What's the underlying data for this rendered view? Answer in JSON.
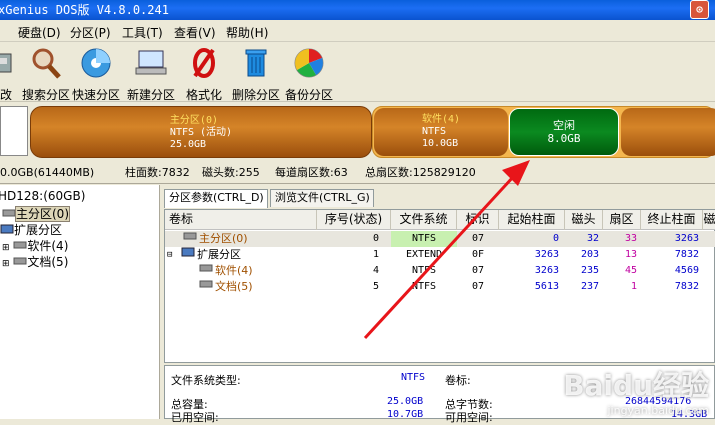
{
  "window": {
    "title": "xGenius DOS版 V4.8.0.241",
    "close_label": "⊙"
  },
  "menu": [
    "硬盘(D)",
    "分区(P)",
    "工具(T)",
    "查看(V)",
    "帮助(H)"
  ],
  "toolbar": [
    {
      "label": "更改",
      "icon": "disk-edit-icon"
    },
    {
      "label": "搜索分区",
      "icon": "magnifier-icon"
    },
    {
      "label": "快速分区",
      "icon": "disk-quick-icon"
    },
    {
      "label": "新建分区",
      "icon": "computer-new-icon"
    },
    {
      "label": "格式化",
      "icon": "format-icon"
    },
    {
      "label": "删除分区",
      "icon": "trash-icon"
    },
    {
      "label": "备份分区",
      "icon": "backup-icon"
    }
  ],
  "diskmap": {
    "main": {
      "name": "主分区(0)",
      "fs": "NTFS (活动)",
      "size": "25.0GB"
    },
    "sw": {
      "name": "软件(4)",
      "fs": "NTFS",
      "size": "10.0GB"
    },
    "free": {
      "name": "空闲",
      "size": "8.0GB"
    }
  },
  "info": {
    "capacity": "0.0GB(61440MB)",
    "cylinders": "柱面数:7832",
    "heads": "磁头数:255",
    "sectors_per_track": "每道扇区数:63",
    "total_sectors": "总扇区数:125829120"
  },
  "tree": {
    "disk": "HD128:(60GB)",
    "items": [
      "主分区(0)",
      "扩展分区",
      "软件(4)",
      "文档(5)"
    ]
  },
  "tabs": [
    "分区参数(CTRL_D)",
    "浏览文件(CTRL_G)"
  ],
  "columns": [
    "卷标",
    "序号(状态)",
    "文件系统",
    "标识",
    "起始柱面",
    "磁头",
    "扇区",
    "终止柱面",
    "磁"
  ],
  "rows": [
    {
      "label": "主分区(0)",
      "index": "0",
      "fs": "NTFS",
      "id": "07",
      "start_cyl": "0",
      "head": "32",
      "sector": "33",
      "end_cyl": "3263"
    },
    {
      "label": "扩展分区",
      "index": "1",
      "fs": "EXTEND",
      "id": "0F",
      "start_cyl": "3263",
      "head": "203",
      "sector": "13",
      "end_cyl": "7832"
    },
    {
      "label": "软件(4)",
      "index": "4",
      "fs": "NTFS",
      "id": "07",
      "start_cyl": "3263",
      "head": "235",
      "sector": "45",
      "end_cyl": "4569"
    },
    {
      "label": "文档(5)",
      "index": "5",
      "fs": "NTFS",
      "id": "07",
      "start_cyl": "5613",
      "head": "237",
      "sector": "1",
      "end_cyl": "7832"
    }
  ],
  "details": {
    "fs_type_label": "文件系统类型:",
    "fs_type_value": "NTFS",
    "volume_label": "卷标:",
    "total_capacity_label": "总容量:",
    "total_capacity_value": "25.0GB",
    "total_bytes_label": "总字节数:",
    "total_bytes_value": "26844594176",
    "used_label": "已用空间:",
    "used_value": "10.7GB",
    "free_label": "可用空间:",
    "free_value": "14.3GB"
  },
  "watermark": {
    "brand": "Baidu经验",
    "url": "jingyan.baidu.com"
  }
}
